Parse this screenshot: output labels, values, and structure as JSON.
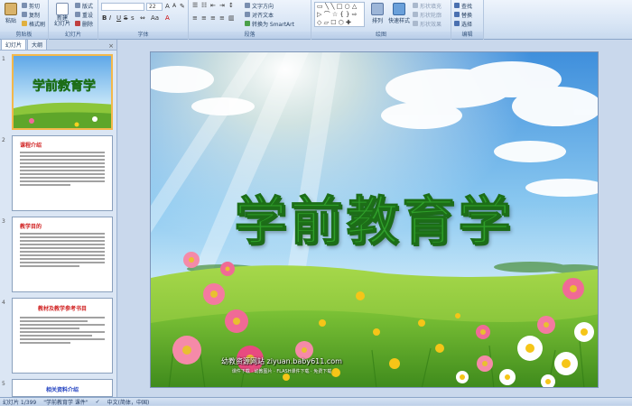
{
  "ribbon": {
    "clipboard": {
      "paste": "粘贴",
      "cut": "剪切",
      "copy": "复制",
      "format_painter": "格式刷",
      "label": "剪贴板"
    },
    "slides": {
      "new_slide": "新建\n幻灯片",
      "layout": "版式",
      "reset": "重设",
      "delete": "删除",
      "label": "幻灯片"
    },
    "font": {
      "font_name": "",
      "font_size": "22",
      "label": "字体"
    },
    "paragraph": {
      "text_direction": "文字方向",
      "align_text": "对齐文本",
      "smartart": "转换为 SmartArt",
      "label": "段落"
    },
    "drawing": {
      "arrange": "排列",
      "quick_styles": "快速样式",
      "shape_fill": "形状填充",
      "shape_outline": "形状轮廓",
      "shape_effects": "形状效果",
      "label": "绘图"
    },
    "editing": {
      "find": "查找",
      "replace": "替换",
      "select": "选择",
      "label": "编辑"
    }
  },
  "panel": {
    "tab_slides": "幻灯片",
    "tab_outline": "大纲",
    "thumbs": [
      {
        "num": "1",
        "title": "学前教育学"
      },
      {
        "num": "2",
        "title": "课程介绍"
      },
      {
        "num": "3",
        "title": "教学目的"
      },
      {
        "num": "4",
        "title": "教材及教学参考书目"
      },
      {
        "num": "5",
        "title": "相关资料介绍"
      }
    ]
  },
  "slide": {
    "title": "学前教育学",
    "site": "幼教资源网站 ziyuan.baby611.com",
    "site_sub": "课件下载 · 幼教图片 · FLASH课件下载 · 免费下载"
  },
  "status": {
    "slide_counter": "幻灯片 1/399",
    "theme": "\"学前教育学 课件\"",
    "language": "中文(简体，中国)"
  },
  "colors": {
    "title_green": "#2f9e2a",
    "selection": "#f4b84a"
  }
}
